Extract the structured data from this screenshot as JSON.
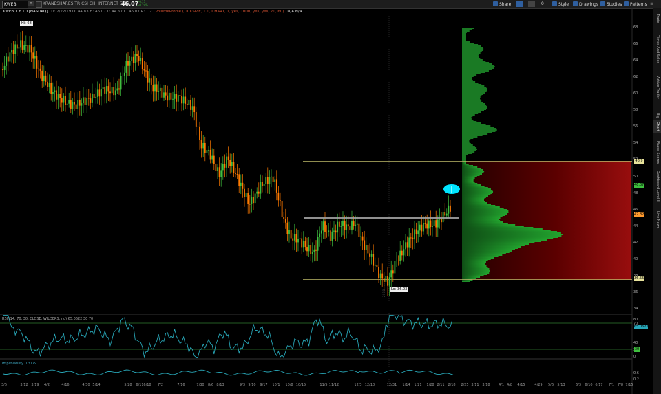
{
  "toolbar": {
    "symbol": "KWEB",
    "description": "KRANESHARES TR CSI CHI INTERNET ETF",
    "last_price": "46.07",
    "change_line1": "+0.11",
    "change_line2": "+0.24%",
    "buttons": {
      "share": "Share",
      "zero": "0",
      "style": "Style",
      "drawings": "Drawings",
      "studies": "Studies",
      "patterns": "Patterns"
    }
  },
  "chart_header": {
    "symbol_label": "KWEB 1 Y 1D [NASDAQ]",
    "ohlc": "D: 2/22/19  O: 44.83  H: 46.07  L: 44.67  C: 46.07  R: 1.2",
    "volume_profile": "VolumeProfile (TICKSIZE, 1.0, CHART, 1, yes, 1000, yes, yes, 70, 60)",
    "na_values": "N/A  N/A"
  },
  "rsi_header": "RSI (14, 70, 30, CLOSE, WILDERS, no)  65.0622  30  70",
  "iv_header": "ImpVolatility  0.3179",
  "watermark": "2018 - ...",
  "price_axis": {
    "ticks": [
      "68",
      "66",
      "64",
      "62",
      "60",
      "58",
      "56",
      "54",
      "52",
      "50",
      "48",
      "46",
      "44",
      "42",
      "40",
      "38",
      "36",
      "34"
    ],
    "tags": {
      "va_high": "48.9",
      "last": "46.07",
      "poc": "42.82",
      "va_low": "36.55"
    },
    "rsi_ticks": [
      "80",
      "70",
      "40",
      "30",
      "0"
    ],
    "rsi_tag": "65.0622",
    "rsi_low_tag": "30",
    "iv_ticks": [
      "0.6",
      "0.2"
    ]
  },
  "annotations": {
    "hi_label": "Hi: 68",
    "lo_label": "Lo: 36.03"
  },
  "side_tabs": [
    "Trade",
    "Times And Sales",
    "Active Trader",
    "Big Buttons",
    "Chart",
    "Phase Scores",
    "Dashboard",
    "Level II",
    "Live News"
  ],
  "active_tab": "Chart",
  "colors": {
    "up": "#3fbf3f",
    "down": "#ff7a00",
    "rsi": "#28a7b8",
    "profile_green": "#1f8f2a",
    "profile_red": "#b31010",
    "resistance": "#a0a0a0",
    "highlight": "#00e5ff"
  },
  "chart_data": {
    "type": "line",
    "title": "KWEB 1 Y 1D [NASDAQ]",
    "x": [
      "3/5",
      "3/12",
      "3/19",
      "4/2",
      "4/16",
      "4/30",
      "5/14",
      "5/28",
      "6/11",
      "6/25",
      "7/9",
      "7/23",
      "8/6",
      "8/20",
      "9/3",
      "9/17",
      "10/1",
      "10/15",
      "10/29",
      "11/12",
      "11/26",
      "12/10",
      "12/24",
      "1/7",
      "1/21",
      "2/4",
      "2/22"
    ],
    "series": [
      {
        "name": "KWEB close",
        "values": [
          66,
          67.5,
          66,
          64,
          62,
          60,
          62,
          63,
          66,
          62,
          60,
          59,
          56,
          52,
          50,
          48,
          46,
          42,
          40,
          44,
          43,
          42,
          37,
          39,
          41,
          44,
          46.07
        ]
      }
    ],
    "xtick_labels": [
      "3/5",
      "3/12",
      "3/19",
      "4/2",
      "4/16",
      "4/30",
      "5/14",
      "5/28",
      "6/11",
      "6/18",
      "7/2",
      "7/16",
      "7/30",
      "8/6",
      "8/13",
      "9/3",
      "9/10",
      "9/17",
      "10/1",
      "10/8",
      "10/15",
      "11/5",
      "11/12",
      "12/3",
      "12/10",
      "12/31",
      "1/14",
      "1/21",
      "1/28",
      "2/11",
      "2/18",
      "2/25",
      "3/11",
      "3/18",
      "4/1",
      "4/8",
      "4/15",
      "4/29",
      "5/6",
      "5/13",
      "6/3",
      "6/10",
      "6/17",
      "7/1",
      "7/8",
      "7/15"
    ],
    "ylim": [
      34,
      69
    ],
    "resistance": 45,
    "volume_profile": {
      "poc": 42.82,
      "va_high": 48.9,
      "va_low": 36.55
    },
    "rsi": {
      "last": 65.0622,
      "overbought": 70,
      "oversold": 30
    },
    "imp_volatility": 0.3179
  }
}
